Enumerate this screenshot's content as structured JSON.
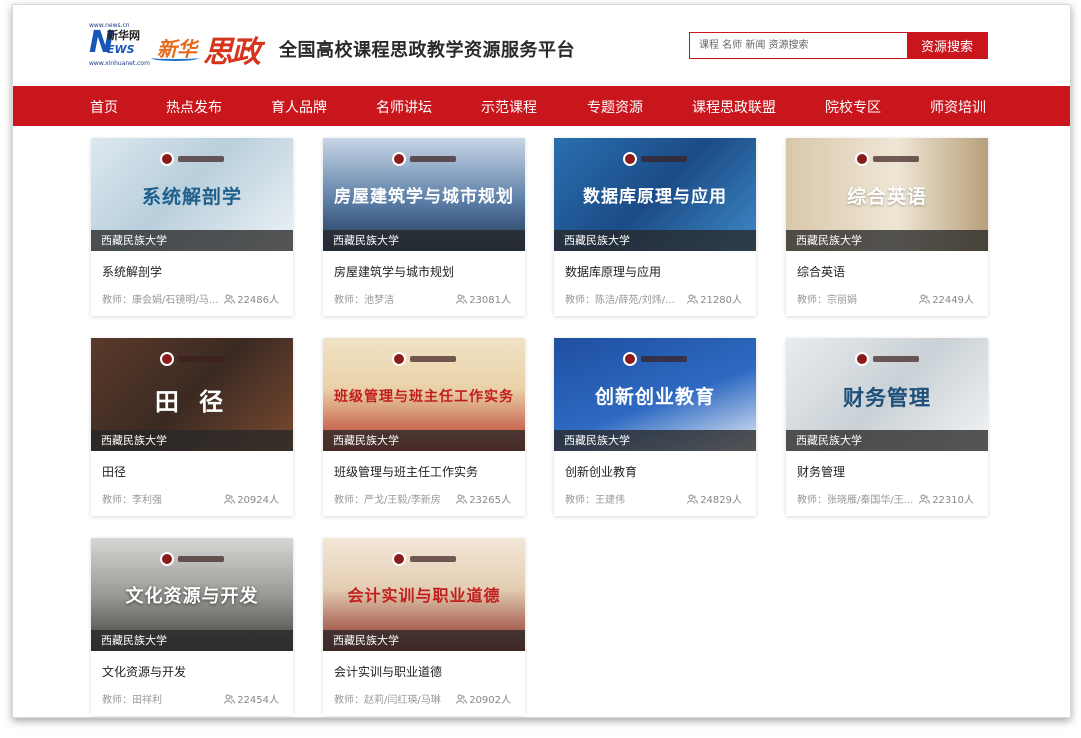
{
  "header": {
    "xinhua_top": "www.news.cn",
    "xinhua_cn": "新华网",
    "xinhua_n": "N",
    "xinhua_ews": "EWS",
    "xinhua_bottom": "www.xinhuanet.com",
    "sizheng_part1": "新华",
    "sizheng_part2": "思政",
    "site_title": "全国高校课程思政教学资源服务平台",
    "search_placeholder": "课程 名师 新闻 资源搜索",
    "search_button": "资源搜索"
  },
  "nav": [
    "首页",
    "热点发布",
    "育人品牌",
    "名师讲坛",
    "示范课程",
    "专题资源",
    "课程思政联盟",
    "院校专区",
    "师资培训"
  ],
  "courses": [
    {
      "title": "系统解剖学",
      "art_title": "系统解剖学",
      "school": "西藏民族大学",
      "teacher": "教师：康会娟/石镜明/马...",
      "count": "22486人"
    },
    {
      "title": "房屋建筑学与城市规划",
      "art_title": "房屋建筑学与城市规划",
      "school": "西藏民族大学",
      "teacher": "教师：池梦洁",
      "count": "23081人"
    },
    {
      "title": "数据库原理与应用",
      "art_title": "数据库原理与应用",
      "school": "西藏民族大学",
      "teacher": "教师：陈洁/薛苑/刘炜/...",
      "count": "21280人"
    },
    {
      "title": "综合英语",
      "art_title": "综合英语",
      "school": "西藏民族大学",
      "teacher": "教师：宗丽娟",
      "count": "22449人"
    },
    {
      "title": "田径",
      "art_title": "田 径",
      "school": "西藏民族大学",
      "teacher": "教师：李利强",
      "count": "20924人"
    },
    {
      "title": "班级管理与班主任工作实务",
      "art_title": "班级管理与班主任工作实务",
      "school": "西藏民族大学",
      "teacher": "教师：严戈/王毅/李新房",
      "count": "23265人"
    },
    {
      "title": "创新创业教育",
      "art_title": "创新创业教育",
      "school": "西藏民族大学",
      "teacher": "教师：王建伟",
      "count": "24829人"
    },
    {
      "title": "财务管理",
      "art_title": "财务管理",
      "school": "西藏民族大学",
      "teacher": "教师：张晓雁/秦国华/王...",
      "count": "22310人"
    },
    {
      "title": "文化资源与开发",
      "art_title": "文化资源与开发",
      "school": "西藏民族大学",
      "teacher": "教师：田祥利",
      "count": "22454人"
    },
    {
      "title": "会计实训与职业道德",
      "art_title": "会计实训与职业道德",
      "school": "西藏民族大学",
      "teacher": "教师：赵莉/闫红瑛/马琳",
      "count": "20902人"
    }
  ],
  "colors": {
    "brand_red": "#c9161d"
  },
  "icons": {
    "count_icon": "users-icon"
  }
}
